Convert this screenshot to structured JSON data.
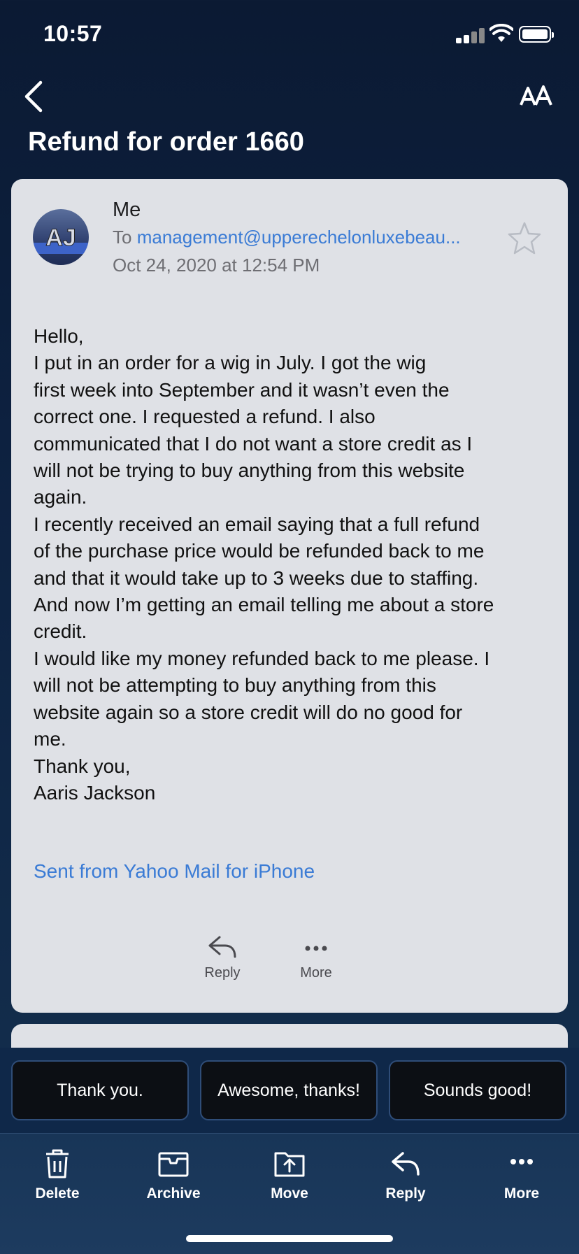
{
  "status_bar": {
    "time": "10:57"
  },
  "header": {
    "subject": "Refund for order 1660"
  },
  "message": {
    "sender": "Me",
    "to_prefix": "To",
    "to_address": "management@upperechelonluxebeau...",
    "date": "Oct 24, 2020 at 12:54 PM",
    "avatar_initials": "AJ",
    "body": "Hello,\nI put in an order for a wig in July. I got the wig\nfirst week into September and it wasn’t even the\ncorrect one. I requested a refund. I also\ncommunicated that I do not want a store credit as I\nwill not be trying to buy anything from this website\nagain.\nI recently received an email saying that a full refund\nof the purchase price would be refunded back to me\nand that it would take up to 3 weeks due to staffing.\nAnd now I’m getting an email telling me about a store\ncredit.\nI would like my money refunded back to me please. I\nwill not be attempting to buy anything from this\nwebsite again so a store credit will do no good for\nme.\nThank you,\nAaris Jackson",
    "signature_link": "Sent from Yahoo Mail for iPhone",
    "actions": {
      "reply": "Reply",
      "more": "More"
    }
  },
  "quick_replies": [
    "Thank you.",
    "Awesome, thanks!",
    "Sounds good!"
  ],
  "toolbar": {
    "delete": "Delete",
    "archive": "Archive",
    "move": "Move",
    "reply": "Reply",
    "more": "More"
  },
  "colors": {
    "link": "#3a7bd5",
    "card": "#dfe1e6",
    "background": "#0d2140"
  }
}
